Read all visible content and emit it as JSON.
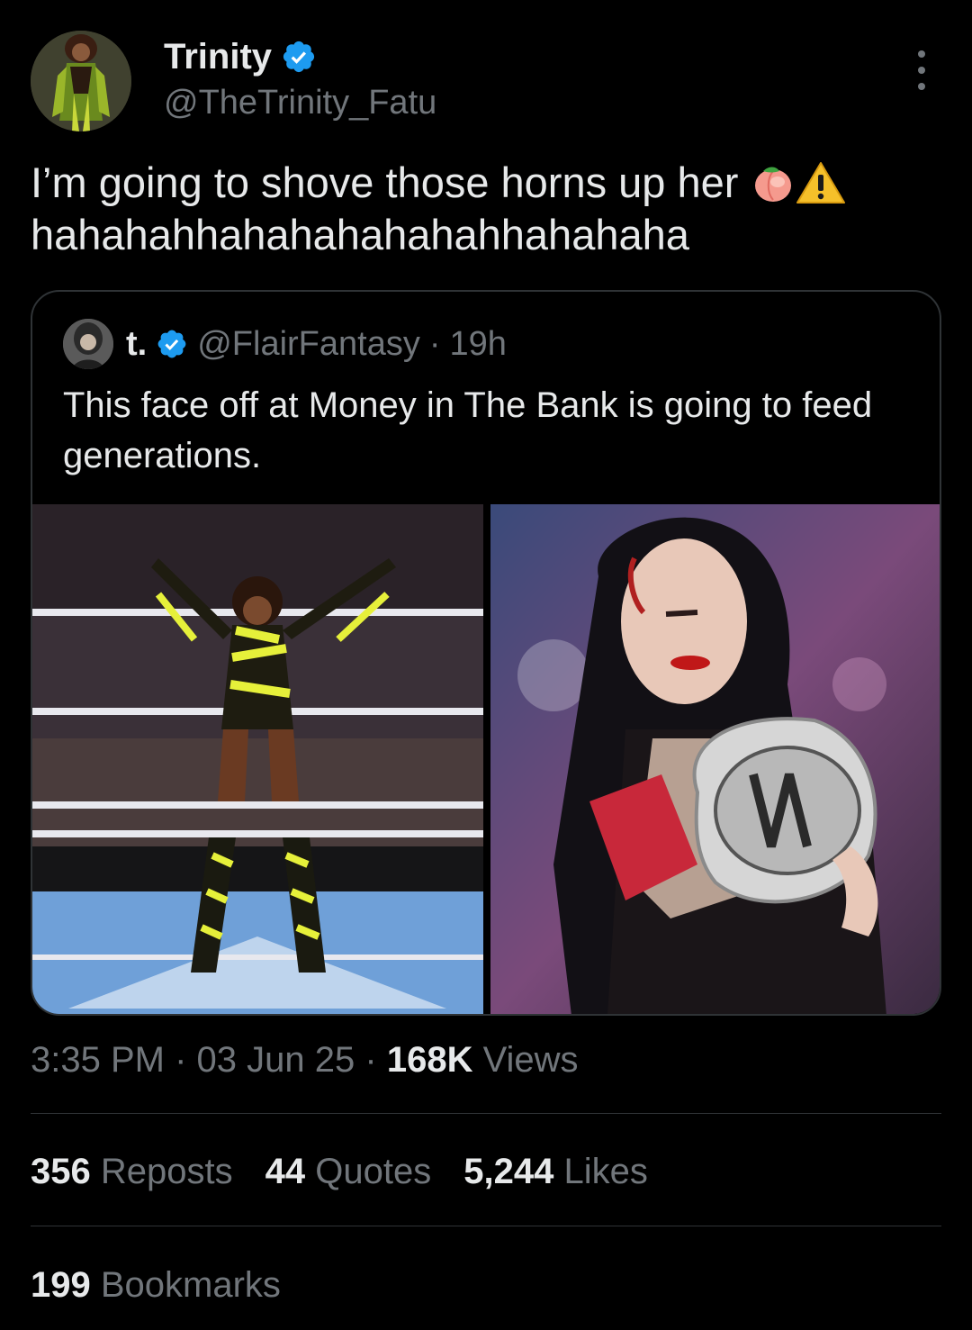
{
  "author": {
    "display_name": "Trinity",
    "handle": "@TheTrinity_Fatu",
    "verified_icon": "verified-badge-icon"
  },
  "tweet": {
    "text_line1": "I’m going to shove those horns up her",
    "text_line2": "hahahahhahahahahahahhahahaha",
    "emojis": [
      "peach-emoji",
      "warning-emoji"
    ]
  },
  "quote": {
    "display_name": "t.",
    "handle": "@FlairFantasy",
    "separator": "·",
    "time": "19h",
    "text": "This face off at Money in The Bank is going to feed generations.",
    "media": [
      "wrestler-in-ring-photo",
      "champion-with-belt-photo"
    ]
  },
  "meta": {
    "time": "3:35 PM",
    "sep1": "·",
    "date": "03 Jun 25",
    "sep2": "·",
    "views_value": "168K",
    "views_label": "Views"
  },
  "stats": {
    "reposts_value": "356",
    "reposts_label": "Reposts",
    "quotes_value": "44",
    "quotes_label": "Quotes",
    "likes_value": "5,244",
    "likes_label": "Likes",
    "bookmarks_value": "199",
    "bookmarks_label": "Bookmarks"
  },
  "colors": {
    "background": "#000000",
    "text_primary": "#e7e9ea",
    "text_secondary": "#71767b",
    "border": "#2f3336",
    "verified": "#1d9bf0"
  }
}
